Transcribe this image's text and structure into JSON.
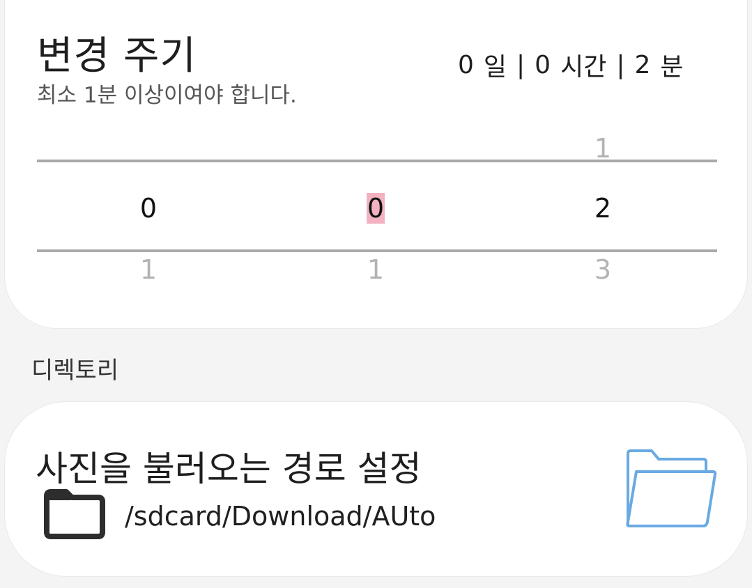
{
  "interval": {
    "title": "변경 주기",
    "subtitle": "최소 1분 이상이여야 합니다.",
    "summary": {
      "days": "0",
      "day_unit": "일",
      "separator": "|",
      "hours": "0",
      "hour_unit": "시간",
      "minutes": "2",
      "minute_unit": "분"
    },
    "picker": {
      "day": {
        "prev": "",
        "current": "0",
        "next": "1"
      },
      "hour": {
        "prev": "",
        "current": "0",
        "next": "1"
      },
      "minute": {
        "prev": "1",
        "current": "2",
        "next": "3"
      }
    }
  },
  "directory": {
    "section_label": "디렉토리",
    "title": "사진을 불러오는 경로 설정",
    "path": "/sdcard/Download/AUto"
  },
  "colors": {
    "background": "#f4f4f4",
    "card": "#ffffff",
    "highlight": "#f2b2c0",
    "folder_accent": "#6aaae3",
    "folder_dark": "#2d2d2d"
  },
  "icons": {
    "small_folder": "folder-icon",
    "big_folder": "folder-open-icon"
  }
}
